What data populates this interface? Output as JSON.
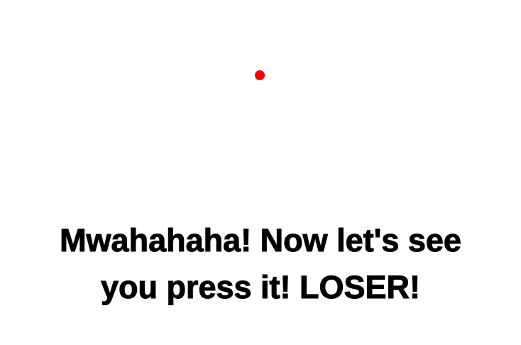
{
  "button": {
    "color": "#ff0000",
    "label": ""
  },
  "message": {
    "line1": "Mwahahaha! Now let's see",
    "line2": "you press it! LOSER!",
    "color": "#000000"
  }
}
